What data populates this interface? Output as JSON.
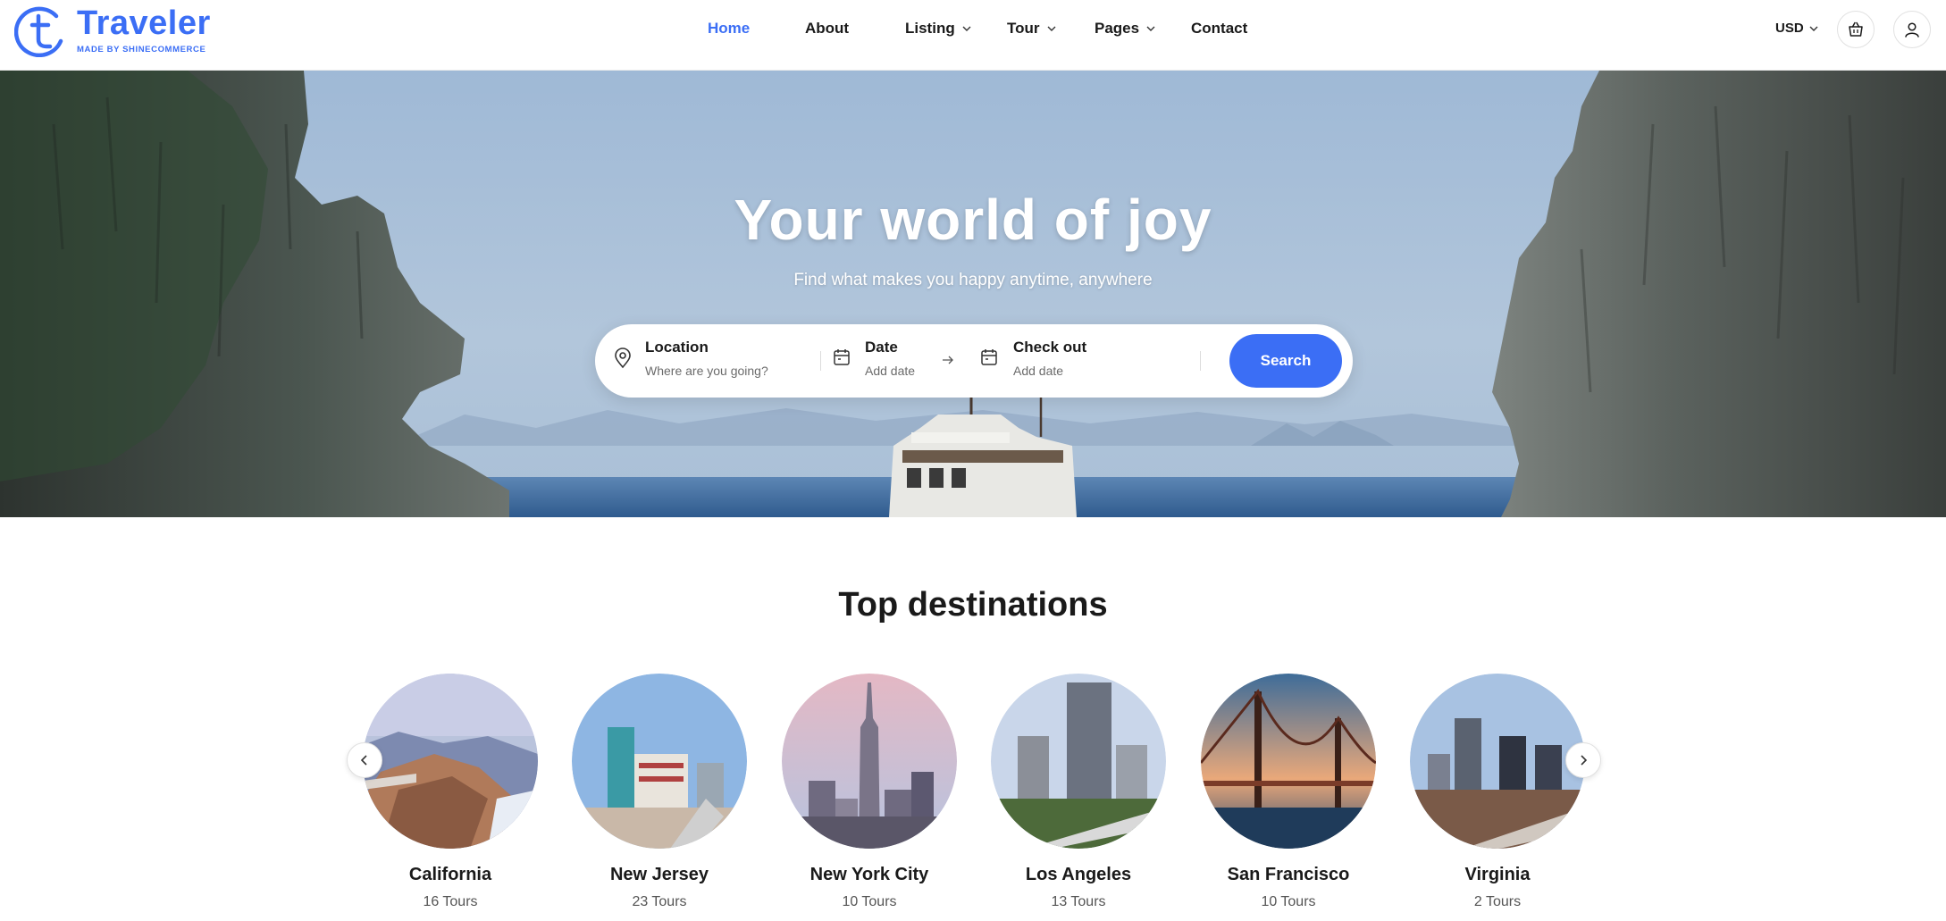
{
  "brand": {
    "name": "Traveler",
    "tagline": "MADE BY SHINECOMMERCE",
    "color": "#3b6ef5"
  },
  "nav": {
    "items": [
      {
        "label": "Home",
        "active": true
      },
      {
        "label": "About"
      },
      {
        "label": "Listing",
        "dropdown": true
      },
      {
        "label": "Tour",
        "dropdown": true
      },
      {
        "label": "Pages",
        "dropdown": true
      },
      {
        "label": "Contact"
      }
    ]
  },
  "header": {
    "currency": "USD",
    "cart_icon": "basket-icon",
    "account_icon": "user-icon"
  },
  "hero": {
    "title": "Your world of joy",
    "subtitle": "Find what makes you happy anytime, anywhere"
  },
  "search": {
    "location_label": "Location",
    "location_placeholder": "Where are you going?",
    "date_label": "Date",
    "date_placeholder": "Add date",
    "checkout_label": "Check out",
    "checkout_placeholder": "Add date",
    "button_label": "Search"
  },
  "destinations": {
    "title": "Top destinations",
    "items": [
      {
        "name": "California",
        "count": "16 Tours"
      },
      {
        "name": "New Jersey",
        "count": "23 Tours"
      },
      {
        "name": "New York City",
        "count": "10 Tours"
      },
      {
        "name": "Los Angeles",
        "count": "13 Tours"
      },
      {
        "name": "San Francisco",
        "count": "10 Tours"
      },
      {
        "name": "Virginia",
        "count": "2 Tours"
      }
    ]
  }
}
